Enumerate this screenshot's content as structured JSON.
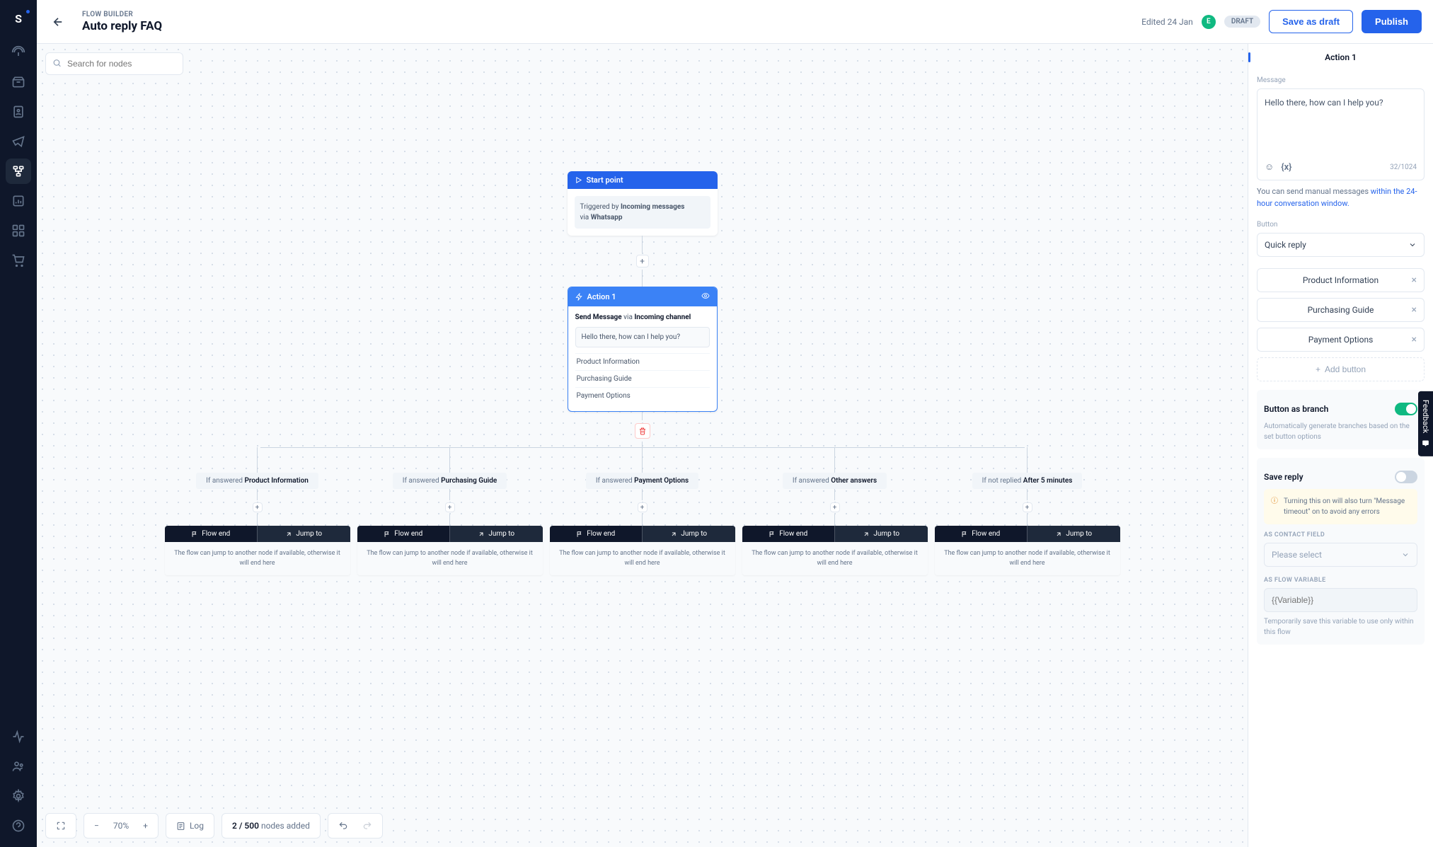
{
  "header": {
    "eyebrow": "FLOW BUILDER",
    "title": "Auto reply FAQ",
    "edited": "Edited 24 Jan",
    "avatar_letter": "E",
    "status": "DRAFT",
    "save_draft": "Save as draft",
    "publish": "Publish"
  },
  "search": {
    "placeholder": "Search for nodes"
  },
  "startNode": {
    "title": "Start point",
    "triggered_prefix": "Triggered by ",
    "triggered_strong": "Incoming messages",
    "via_prefix": "via ",
    "via_strong": "Whatsapp"
  },
  "actionNode": {
    "title": "Action 1",
    "action_prefix": "Send Message ",
    "action_via": "via ",
    "action_channel": "Incoming channel",
    "message": "Hello there, how can I help you?",
    "options": [
      "Product Information",
      "Purchasing Guide",
      "Payment Options"
    ]
  },
  "branches": [
    {
      "prefix": "If answered ",
      "label": "Product Information"
    },
    {
      "prefix": "If answered ",
      "label": "Purchasing Guide"
    },
    {
      "prefix": "If answered ",
      "label": "Payment Options"
    },
    {
      "prefix": "If answered ",
      "label": "Other answers"
    },
    {
      "prefix": "If not replied ",
      "label": "After 5 minutes"
    }
  ],
  "flowEnd": {
    "title": "Flow end",
    "jump": "Jump to",
    "desc": "The flow can jump to another node if available, otherwise it will end here"
  },
  "bottomBar": {
    "zoom": "70%",
    "log": "Log",
    "nodes_count": "2 / 500",
    "nodes_suffix": " nodes added"
  },
  "rightPanel": {
    "tab": "Action 1",
    "message_label": "Message",
    "message_text": "Hello there, how can I help you?",
    "char_count": "32/1024",
    "hint_prefix": "You can send manual messages ",
    "hint_link": "within the 24-hour conversation window.",
    "button_label": "Button",
    "button_type": "Quick reply",
    "buttons": [
      "Product Information",
      "Purchasing Guide",
      "Payment Options"
    ],
    "add_button": "Add button",
    "branch_toggle": "Button as branch",
    "branch_desc": "Automatically generate branches based on the set button options",
    "save_reply": "Save reply",
    "save_warn": "Turning this on will also turn \"Message timeout\" on to avoid any errors",
    "contact_field_label": "AS CONTACT FIELD",
    "contact_field_placeholder": "Please select",
    "flow_var_label": "AS FLOW VARIABLE",
    "flow_var_placeholder": "{{Variable}}",
    "flow_var_hint": "Temporarily save this variable to use only within this flow"
  },
  "feedback": "Feedback"
}
